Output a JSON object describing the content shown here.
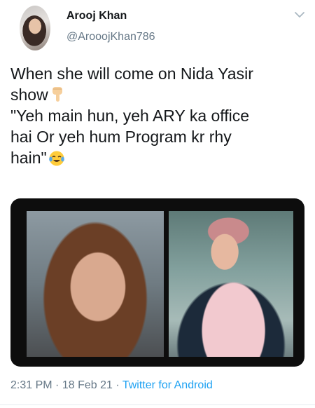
{
  "tweet": {
    "author_name": "Arooj Khan",
    "author_handle": "@ArooojKhan786",
    "text_lines": [
      "When she will come on Nida Yasir",
      "show",
      "\"Yeh main hun, yeh ARY ka office",
      "hai Or yeh hum Program kr rhy",
      "hain\""
    ],
    "emojis": [
      "pointing-down-emoji",
      "tears-of-joy-emoji"
    ],
    "time": "2:31 PM",
    "separator": "·",
    "date": "18 Feb 21",
    "source": "Twitter for Android"
  },
  "colors": {
    "text": "#14171a",
    "secondary": "#657786",
    "link": "#1da1f2",
    "media_background": "#0d0d0d"
  }
}
